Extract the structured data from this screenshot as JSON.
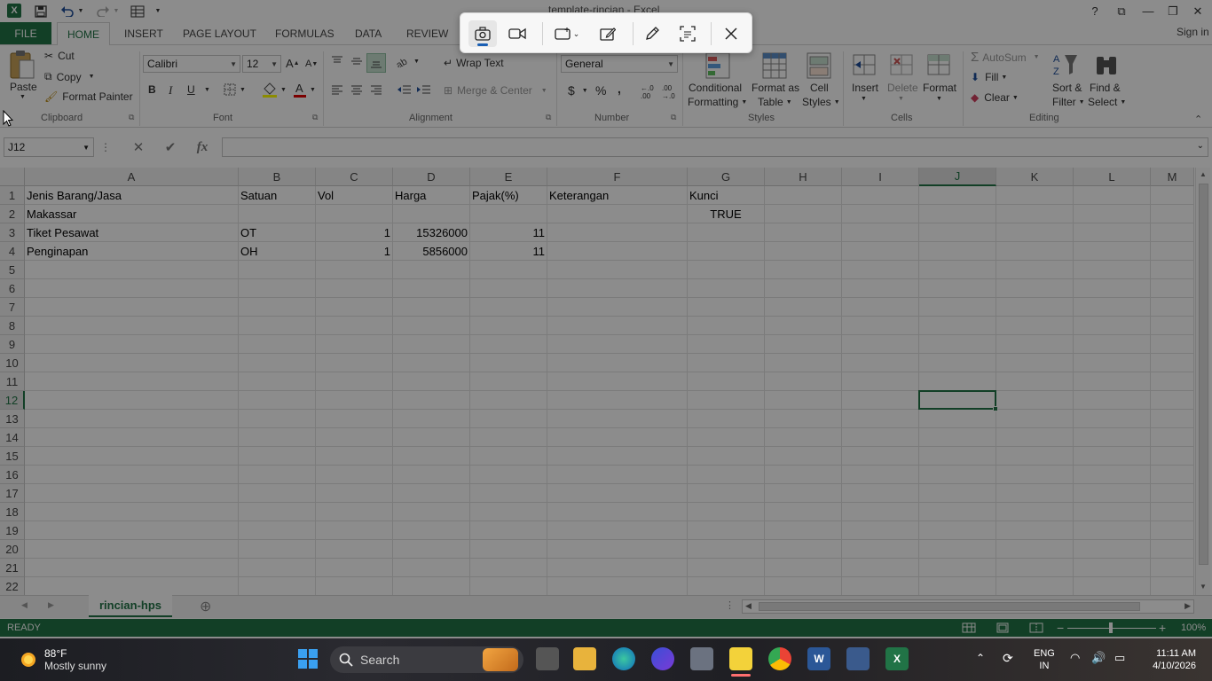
{
  "window": {
    "title": "template-rincian - Excel",
    "help": "?",
    "minimize": "—",
    "restore": "❐",
    "close": "✕",
    "ribbon_display": "⧉"
  },
  "ribbon_tabs": {
    "file": "FILE",
    "home": "HOME",
    "insert": "INSERT",
    "page_layout": "PAGE LAYOUT",
    "formulas": "FORMULAS",
    "data": "DATA",
    "review": "REVIEW",
    "sign_in": "Sign in"
  },
  "clipboard": {
    "paste": "Paste",
    "cut": "Cut",
    "copy": "Copy",
    "format_painter": "Format Painter",
    "label": "Clipboard"
  },
  "font": {
    "name": "Calibri",
    "size": "12",
    "bold": "B",
    "italic": "I",
    "underline": "U",
    "label": "Font"
  },
  "alignment": {
    "wrap_text": "Wrap Text",
    "merge_center": "Merge & Center",
    "label": "Alignment"
  },
  "number": {
    "format": "General",
    "currency": "$",
    "percent": "%",
    "comma": ",",
    "label": "Number"
  },
  "styles": {
    "conditional_formatting_1": "Conditional",
    "conditional_formatting_2": "Formatting",
    "format_as_table_1": "Format as",
    "format_as_table_2": "Table",
    "cell_styles_1": "Cell",
    "cell_styles_2": "Styles",
    "label": "Styles"
  },
  "cells": {
    "insert": "Insert",
    "delete": "Delete",
    "format": "Format",
    "label": "Cells"
  },
  "editing": {
    "autosum": "AutoSum",
    "fill": "Fill",
    "clear": "Clear",
    "sort_filter_1": "Sort &",
    "sort_filter_2": "Filter",
    "find_select_1": "Find &",
    "find_select_2": "Select",
    "label": "Editing"
  },
  "formula_bar": {
    "name_box": "J12",
    "cancel": "✕",
    "enter": "✔",
    "fx": "fx",
    "value": ""
  },
  "columns": [
    "A",
    "B",
    "C",
    "D",
    "E",
    "F",
    "G",
    "H",
    "I",
    "J",
    "K",
    "L",
    "M"
  ],
  "rows": [
    "1",
    "2",
    "3",
    "4",
    "5",
    "6",
    "7",
    "8",
    "9",
    "10",
    "11",
    "12",
    "13",
    "14",
    "15",
    "16",
    "17",
    "18",
    "19",
    "20",
    "21",
    "22"
  ],
  "cells_data": {
    "A1": "Jenis Barang/Jasa",
    "B1": "Satuan",
    "C1": "Vol",
    "D1": "Harga",
    "E1": "Pajak(%)",
    "F1": "Keterangan",
    "G1": "Kunci",
    "A2": "Makassar",
    "G2": "TRUE",
    "A3": "Tiket Pesawat",
    "B3": "OT",
    "C3": "1",
    "D3": "15326000",
    "E3": "11",
    "A4": "Penginapan",
    "B4": "OH",
    "C4": "1",
    "D4": "5856000",
    "E4": "11"
  },
  "sheet_tabs": {
    "active": "rincian-hps",
    "add": "⊕"
  },
  "status_bar": {
    "mode": "READY",
    "zoom": "100%",
    "zoom_out": "−",
    "zoom_in": "+"
  },
  "taskbar": {
    "weather_temp": "88°F",
    "weather_desc": "Mostly sunny",
    "search_placeholder": "Search",
    "lang_1": "ENG",
    "lang_2": "IN",
    "time": "11:11 AM",
    "date": "4/10/2026"
  },
  "colors": {
    "excel_green": "#217346",
    "overlay": "rgba(0,0,0,0.45)"
  }
}
